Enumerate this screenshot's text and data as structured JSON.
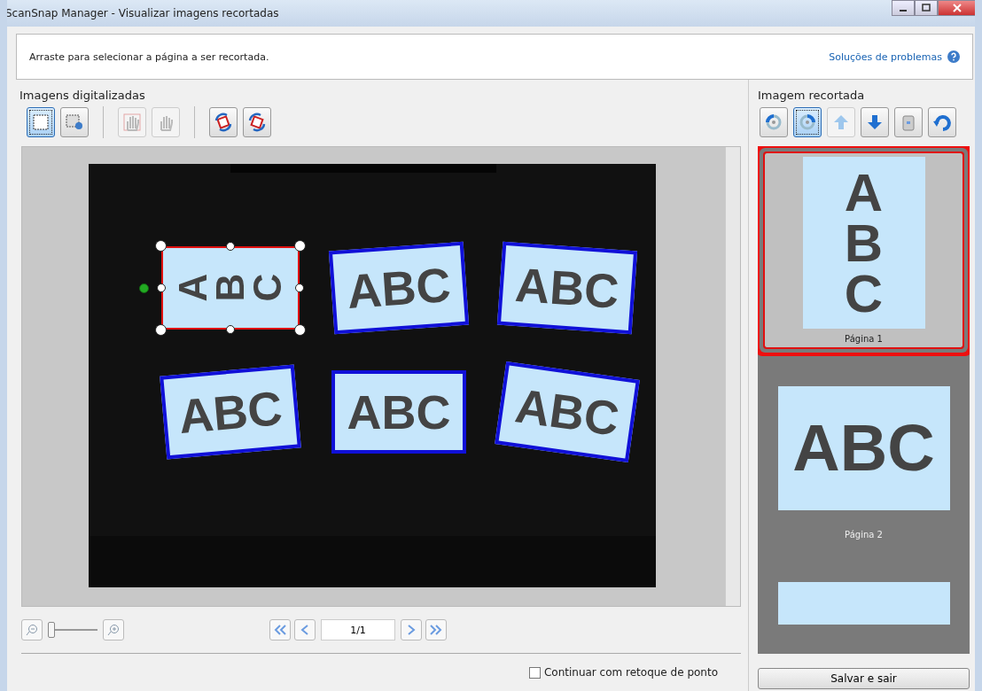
{
  "window": {
    "title": "ScanSnap Manager - Visualizar imagens recortadas"
  },
  "instruction": {
    "text": "Arraste para selecionar a página a ser recortada.",
    "help_link": "Soluções de problemas"
  },
  "scanned": {
    "heading": "Imagens digitalizadas",
    "tools": [
      {
        "kind": "select",
        "selected": true,
        "disabled": false
      },
      {
        "kind": "add",
        "selected": false,
        "disabled": false
      },
      {
        "kind": "hand-frame",
        "selected": false,
        "disabled": true
      },
      {
        "kind": "hand",
        "selected": false,
        "disabled": true
      },
      {
        "kind": "rotate-left",
        "selected": false,
        "disabled": false
      },
      {
        "kind": "rotate-right",
        "selected": false,
        "disabled": false
      }
    ],
    "cards": [
      {
        "text": "ABC",
        "kind": "portrait",
        "selected": true
      },
      {
        "text": "ABC",
        "kind": "landscape",
        "selected": false
      },
      {
        "text": "ABC",
        "kind": "landscape",
        "selected": false
      },
      {
        "text": "ABC",
        "kind": "landscape",
        "selected": false
      },
      {
        "text": "ABC",
        "kind": "landscape",
        "selected": false
      },
      {
        "text": "ABC",
        "kind": "landscape",
        "selected": false
      }
    ],
    "zoom": {
      "level": 0.0
    },
    "page_field": {
      "value": "1/1"
    }
  },
  "cropped": {
    "heading": "Imagem recortada",
    "tools": [
      {
        "kind": "rotate-left",
        "selected": false,
        "disabled": false
      },
      {
        "kind": "rotate-right",
        "selected": true,
        "disabled": false
      },
      {
        "kind": "up",
        "selected": false,
        "disabled": true
      },
      {
        "kind": "down",
        "selected": false,
        "disabled": false
      },
      {
        "kind": "trash",
        "selected": false,
        "disabled": false
      },
      {
        "kind": "undo",
        "selected": false,
        "disabled": false
      }
    ],
    "thumbnails": [
      {
        "text": "ABC",
        "kind": "portrait",
        "label": "Página 1",
        "selected": true
      },
      {
        "text": "ABC",
        "kind": "landscape",
        "label": "Página 2",
        "selected": false
      },
      {
        "kind": "landscape",
        "selected": false
      }
    ]
  },
  "retouch": {
    "label": "Continuar com retoque de ponto",
    "checked": false
  },
  "save_button": "Salvar e sair"
}
